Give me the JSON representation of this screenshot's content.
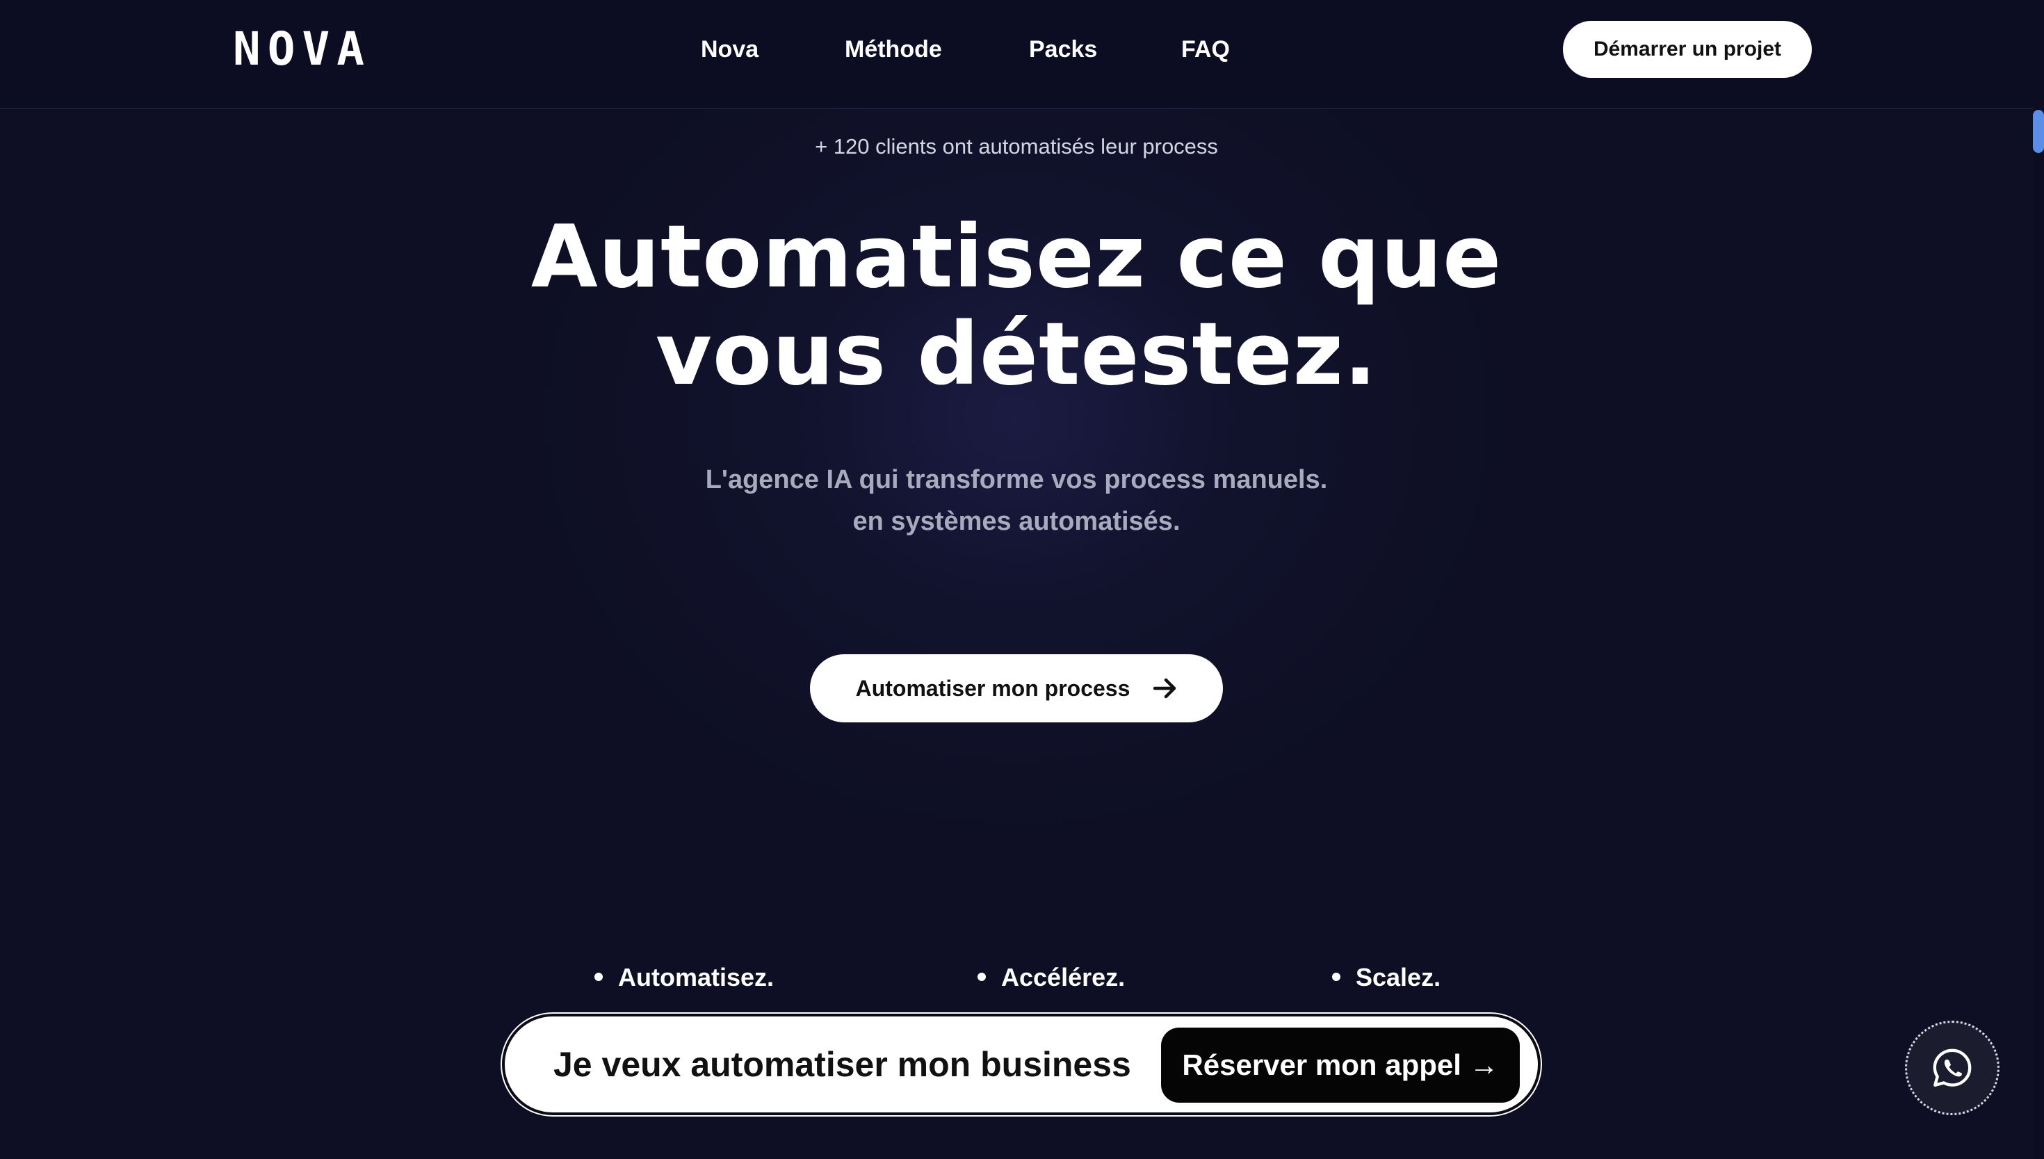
{
  "navbar": {
    "logo": "NOVA",
    "links": [
      "Nova",
      "Méthode",
      "Packs",
      "FAQ"
    ],
    "cta_label": "Démarrer un projet"
  },
  "hero": {
    "clients_note": "+ 120 clients ont automatisés leur process",
    "title_line1": "Automatisez ce que",
    "title_line2": "vous détestez.",
    "subtitle_line1": "L'agence IA qui transforme vos process manuels.",
    "subtitle_line2": "en systèmes automatisés.",
    "cta_label": "Automatiser mon process",
    "cta_icon": "arrow-right-icon"
  },
  "bullets": [
    "Automatisez.",
    "Accélérez.",
    "Scalez."
  ],
  "sticky_bar": {
    "text": "Je veux automatiser mon business",
    "cta_label": "Réserver mon appel →"
  },
  "floating": {
    "icon": "whatsapp-icon"
  },
  "colors": {
    "background": "#0e0f24",
    "navbar": "#0c0d22",
    "subtitle": "#a9aabd",
    "button_light": "#ffffff",
    "button_dark": "#050505",
    "scrollbar_thumb": "#5b8ee6"
  }
}
